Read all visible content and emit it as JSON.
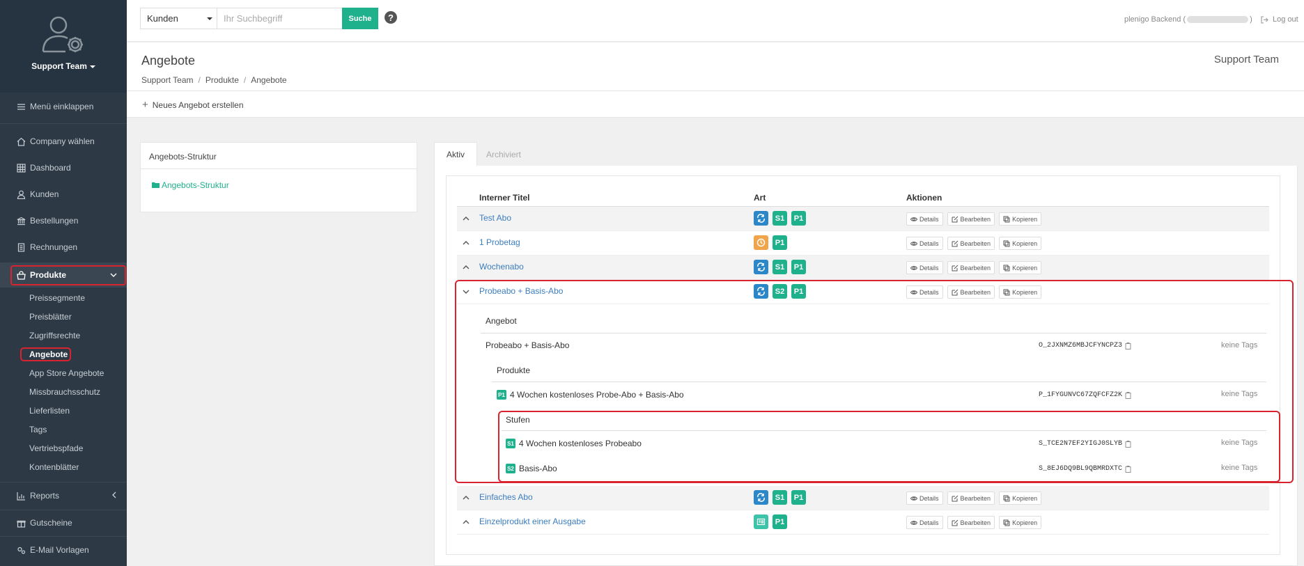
{
  "sidebar": {
    "team_label": "Support Team",
    "collapse_label": "Menü einklappen",
    "items": {
      "company": "Company wählen",
      "dashboard": "Dashboard",
      "kunden": "Kunden",
      "bestellungen": "Bestellungen",
      "rechnungen": "Rechnungen",
      "produkte": "Produkte",
      "reports": "Reports",
      "gutscheine": "Gutscheine",
      "email": "E-Mail Vorlagen"
    },
    "sub_items": {
      "preissegmente": "Preissegmente",
      "preisblaetter": "Preisblätter",
      "zugriffsrechte": "Zugriffsrechte",
      "angebote": "Angebote",
      "appstore": "App Store Angebote",
      "missbrauch": "Missbrauchsschutz",
      "lieferlisten": "Lieferlisten",
      "tags": "Tags",
      "vertriebspfade": "Vertriebspfade",
      "kontenblaetter": "Kontenblätter"
    }
  },
  "topbar": {
    "select_value": "Kunden",
    "search_placeholder": "Ihr Suchbegriff",
    "search_button": "Suche",
    "help": "?",
    "user_label": "plenigo Backend (",
    "user_label_end": ")",
    "logout": "Log out"
  },
  "header": {
    "title": "Angebote",
    "breadcrumb": [
      "Support Team",
      "Produkte",
      "Angebote"
    ],
    "breadcrumb_sep": "/",
    "right_label": "Support Team",
    "new_offer": "Neues Angebot erstellen"
  },
  "left_panel": {
    "title": "Angebots-Struktur",
    "link": "Angebots-Struktur"
  },
  "tabs": [
    "Aktiv",
    "Archiviert"
  ],
  "table": {
    "headers": [
      "Interner Titel",
      "Art",
      "Aktionen"
    ],
    "actions": [
      "Details",
      "Bearbeiten",
      "Kopieren"
    ],
    "rows": [
      {
        "title": "Test Abo",
        "badges": [
          "S1",
          "P1"
        ]
      },
      {
        "title": "1 Probetag",
        "badges": [
          "P1"
        ]
      },
      {
        "title": "Wochenabo",
        "badges": [
          "S1",
          "P1"
        ]
      },
      {
        "title": "Probeabo + Basis-Abo",
        "badges": [
          "S2",
          "P1"
        ]
      },
      {
        "title": "Einfaches Abo",
        "badges": [
          "S1",
          "P1"
        ]
      },
      {
        "title": "Einzelprodukt einer Ausgabe",
        "badges": [
          "P1"
        ]
      }
    ]
  },
  "detail": {
    "section_offer": "Angebot",
    "offer_name": "Probeabo + Basis-Abo",
    "offer_code": "O_2JXNMZ6MBJCFYNCPZ3",
    "section_products": "Produkte",
    "product_badge": "P1",
    "product_name": "4 Wochen kostenloses Probe-Abo + Basis-Abo",
    "product_code": "P_1FYGUNVC67ZQFCFZ2K",
    "section_stages": "Stufen",
    "stage1_badge": "S1",
    "stage1_name": "4 Wochen kostenloses Probeabo",
    "stage1_code": "S_TCE2N7EF2YIGJ0SLYB",
    "stage2_badge": "S2",
    "stage2_name": "Basis-Abo",
    "stage2_code": "S_8EJ6DQ9BL9QBMRDXTC",
    "no_tags": "keine Tags"
  },
  "colors": {
    "accent": "#1fb08c",
    "sidebar_bg": "#2d3a46",
    "link": "#3b7dbf",
    "highlight": "#d9232e",
    "badge_blue": "#2b87c8",
    "badge_orange": "#f0a54c"
  }
}
